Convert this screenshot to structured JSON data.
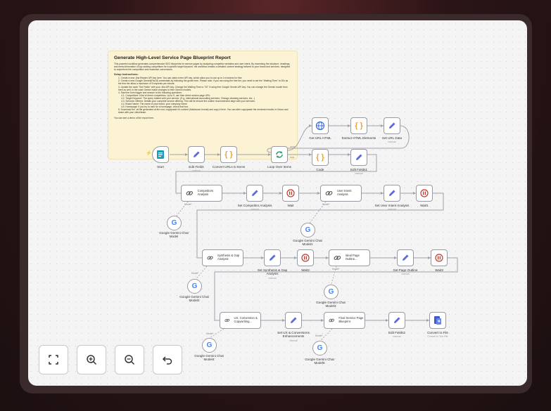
{
  "sticky": {
    "title": "Generate High-Level Service Page Blueprint Report",
    "intro": "This powerful workflow generates comprehensive SEO blueprints for service pages by analyzing competitor websites and user intent. By examining the structure, headings, and meta information of top-ranking competitors for a specific target keyword, the workflow creates a detailed content strategy tailored to your brand and services, designed to outperform the competition and maximize conversions.",
    "setup_heading": "Setup Instructions:",
    "steps": [
      "1. Create a new Jina Reader API key here. You can claim a free API key, which allow you to use up to 1m tokens for free.",
      "2. Create a new Google Gemini(PaLM) credentials by following the guide here. Please note, if you are using the free tier, you need to set the \"Waiting Time\" to 20s as the free tier allow a maximum of 5 requests per minute.",
      "3. Update the node \"Set Fields\" with your Jina API key. Change the Waiting Time to \"20\" if using free Google Gemini API key. You can change the Gemini model from here as well, in the case Gemini make changes to their Gemini models.",
      "4. Start the form trigger and answer to the following questions:",
      "4.1. Competitors: A list of direct competitors. Up to 5, use their direct service page URL.",
      "4.2. Target Keyword: The query related with your service. (E.g. international accounting services, Chicago cleaning services, etc...)",
      "4.3. Services Offered: Details your complete service offering. This will be ensure the outline recommended align with your services.",
      "4.4. Brand Name: The name of your brand, your company name.",
      "4.5. Homepage: If you try to rank for a homepage, check that box.",
      "5. Download the .txt file generated at the end, copy/paste it's content (Markdown format) and copy it here. You can after copy/paste the rendered results in Gdocs and share with your client/team."
    ],
    "demo": "You can see a demo of the report here."
  },
  "nodes": {
    "start": {
      "label": "Start"
    },
    "edit_fields": {
      "label": "Edit Fields",
      "sub": "manual"
    },
    "convert_urls": {
      "label": "Convert URLs to Items"
    },
    "loop": {
      "label": "Loop Over Items"
    },
    "get_url_html": {
      "label": "Get URL HTML"
    },
    "extract_html": {
      "label": "Extract HTML Elements"
    },
    "set_url_data": {
      "label": "Set URL Data",
      "sub": "manual"
    },
    "code": {
      "label": "Code"
    },
    "edit_fields1": {
      "label": "Edit Fields1",
      "sub": "manual"
    },
    "competitors": {
      "label": "Competitors Analysis",
      "port": "Model*"
    },
    "gemini0": {
      "label": "Google Gemini Chat Model"
    },
    "set_competitor": {
      "label": "Set Competitor Analysis",
      "sub": "manual"
    },
    "wait": {
      "label": "Wait"
    },
    "user_intent": {
      "label": "User Intent Analysis",
      "port": "Model*"
    },
    "gemini1": {
      "label": "Google Gemini Chat Model1"
    },
    "set_user_intent": {
      "label": "Set User Intent Analysis",
      "sub": "manual"
    },
    "wait1": {
      "label": "Wait1"
    },
    "synthesis": {
      "label": "Synthesis & Gap Analysis",
      "port": "Model*"
    },
    "gemini2": {
      "label": "Google Gemini Chat Model2"
    },
    "set_synthesis": {
      "label": "Set Synthesis & Gap Analysis",
      "sub": "manual"
    },
    "wait2": {
      "label": "Wait2"
    },
    "ideal_outline": {
      "label": "Ideal Page Outline...",
      "port": "Model*"
    },
    "gemini3": {
      "label": "Google Gemini Chat Model3"
    },
    "set_outline": {
      "label": "Set Page Outline",
      "sub": "manual"
    },
    "wait3": {
      "label": "Wait3"
    },
    "ux": {
      "label": "UX, Conversion & Copywriting...",
      "port": "Model*"
    },
    "gemini4": {
      "label": "Google Gemini Chat Model4"
    },
    "set_ux": {
      "label": "Set UX & Conversions Enhancements",
      "sub": "manual"
    },
    "final": {
      "label": "Final Service Page Blueprint",
      "port": "Model*"
    },
    "gemini5": {
      "label": "Google Gemini Chat Model5"
    },
    "edit_fields2": {
      "label": "Edit Fields2",
      "sub": "manual"
    },
    "convert_file": {
      "label": "Convert to File",
      "sub": "Convert to Text File"
    }
  },
  "port_labels": {
    "done": "done",
    "loop": "loop"
  },
  "colors": {
    "accent": "#e4562e",
    "node_border": "#9a9aa2",
    "wire": "#a1a1aa",
    "ai_purple": "#7c6ad6"
  }
}
